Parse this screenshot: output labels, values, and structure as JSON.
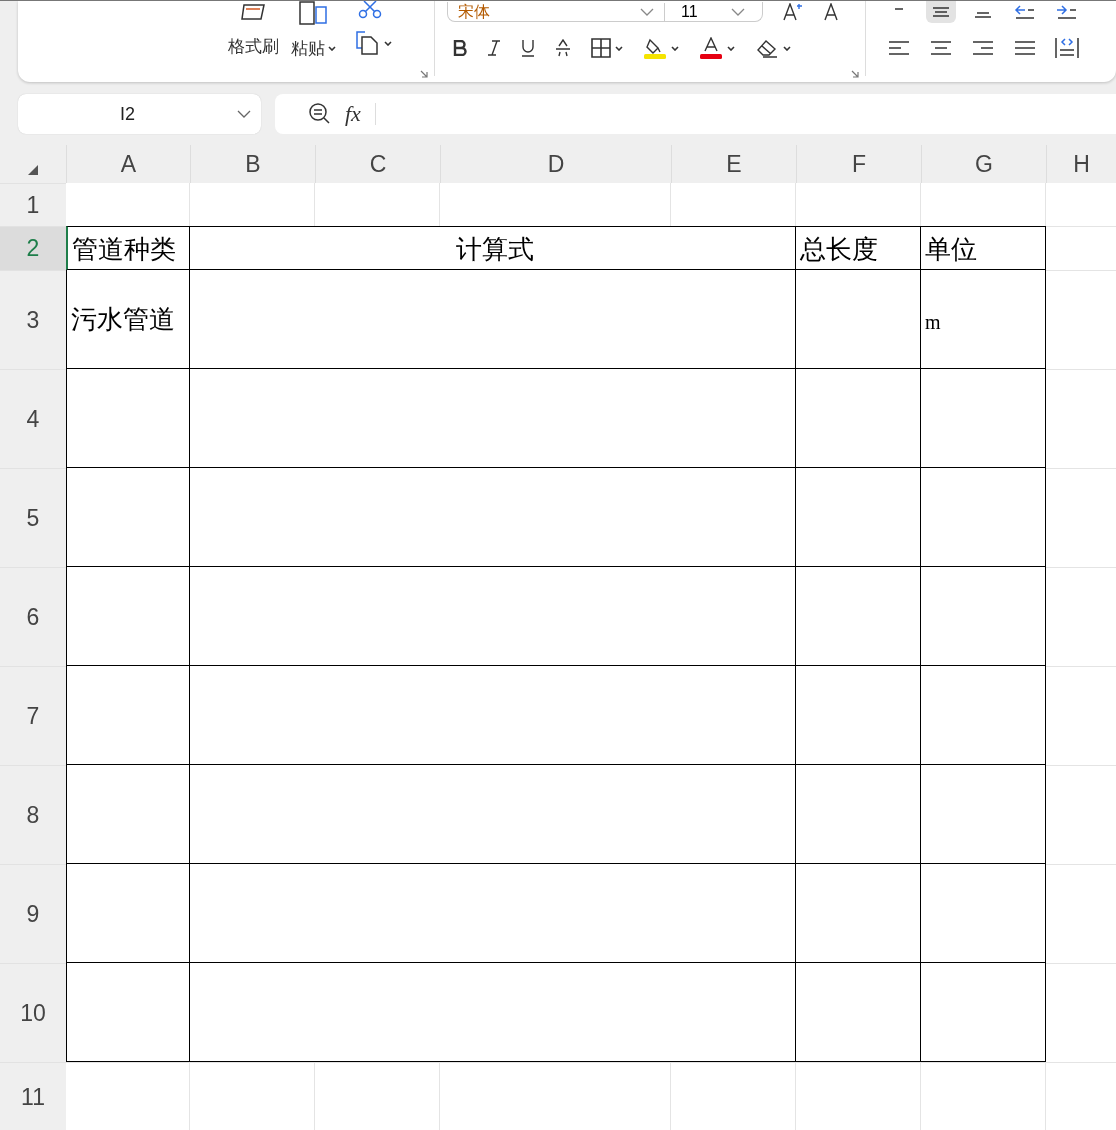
{
  "ribbon": {
    "format_painter": {
      "label": "格式刷"
    },
    "paste": {
      "label": "粘贴"
    },
    "font": {
      "name": "宋体",
      "size": "11"
    },
    "font_buttons": [
      {
        "kind": "bold"
      },
      {
        "kind": "italic"
      },
      {
        "kind": "underline"
      },
      {
        "kind": "strike"
      },
      {
        "kind": "borders"
      },
      {
        "kind": "fill",
        "color": "#f5e400"
      },
      {
        "kind": "font-color",
        "color": "#e60012"
      },
      {
        "kind": "eraser"
      }
    ],
    "align_top_row": [
      {
        "kind": "align-top",
        "selected": false
      },
      {
        "kind": "align-middle",
        "selected": true
      },
      {
        "kind": "align-bottom",
        "selected": false
      },
      {
        "kind": "indent-decrease",
        "selected": false
      },
      {
        "kind": "indent-increase",
        "selected": false
      }
    ],
    "align_bottom_row": [
      {
        "kind": "align-left",
        "selected": false
      },
      {
        "kind": "align-center",
        "selected": false
      },
      {
        "kind": "align-right",
        "selected": false
      },
      {
        "kind": "justify",
        "selected": false
      },
      {
        "kind": "distribute",
        "selected": false
      }
    ]
  },
  "formula_bar": {
    "name_box": "I2",
    "fx_label": "fx"
  },
  "columns": [
    {
      "label": "A",
      "selected": false
    },
    {
      "label": "B",
      "selected": false
    },
    {
      "label": "C",
      "selected": false
    },
    {
      "label": "D",
      "selected": false
    },
    {
      "label": "E",
      "selected": false
    },
    {
      "label": "F",
      "selected": false
    },
    {
      "label": "G",
      "selected": false
    },
    {
      "label": "H",
      "selected": false
    }
  ],
  "rows": [
    {
      "number": "1",
      "selected": false,
      "kind": "blank"
    },
    {
      "number": "2",
      "selected": true,
      "kind": "header",
      "cells": [
        "管道种类",
        "计算式",
        "总长度",
        "单位"
      ]
    },
    {
      "number": "3",
      "selected": false,
      "kind": "data",
      "cells": [
        "污水管道",
        "",
        "",
        "m"
      ]
    },
    {
      "number": "4",
      "selected": false,
      "kind": "data",
      "cells": [
        "",
        "",
        "",
        ""
      ]
    },
    {
      "number": "5",
      "selected": false,
      "kind": "data",
      "cells": [
        "",
        "",
        "",
        ""
      ]
    },
    {
      "number": "6",
      "selected": false,
      "kind": "data",
      "cells": [
        "",
        "",
        "",
        ""
      ]
    },
    {
      "number": "7",
      "selected": false,
      "kind": "data",
      "cells": [
        "",
        "",
        "",
        ""
      ]
    },
    {
      "number": "8",
      "selected": false,
      "kind": "data",
      "cells": [
        "",
        "",
        "",
        ""
      ]
    },
    {
      "number": "9",
      "selected": false,
      "kind": "data",
      "cells": [
        "",
        "",
        "",
        ""
      ]
    },
    {
      "number": "10",
      "selected": false,
      "kind": "data",
      "cells": [
        "",
        "",
        "",
        ""
      ]
    },
    {
      "number": "11",
      "selected": false,
      "kind": "blank"
    }
  ]
}
